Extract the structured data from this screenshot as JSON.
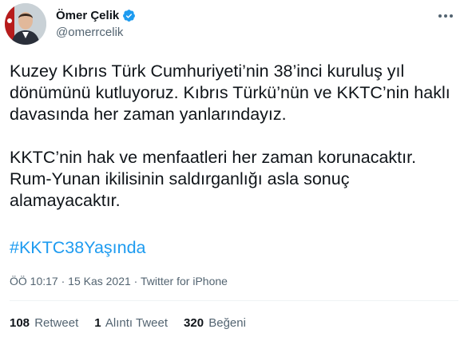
{
  "user": {
    "display_name": "Ömer Çelik",
    "handle": "@omerrcelik",
    "verified": true,
    "avatar_icon": "person-portrait"
  },
  "tweet": {
    "paragraph1": "Kuzey Kıbrıs Türk Cumhuriyeti’nin 38’inci kuruluş yıl dönümünü kutluyoruz. Kıbrıs Türkü’nün ve KKTC’nin haklı davasında her zaman yanlarındayız.",
    "paragraph2": "KKTC’nin hak ve menfaatleri her zaman korunacaktır. Rum-Yunan ikilisinin saldırganlığı asla sonuç alamayacaktır.",
    "hashtag": "#KKTC38Yaşında"
  },
  "meta": {
    "time": "ÖÖ 10:17",
    "separator": " · ",
    "date": "15 Kas 2021",
    "app": "Twitter for iPhone"
  },
  "stats": {
    "retweets_count": "108",
    "retweets_label": "Retweet",
    "quotes_count": "1",
    "quotes_label": "Alıntı Tweet",
    "likes_count": "320",
    "likes_label": "Beğeni"
  },
  "colors": {
    "link": "#1d9bf0",
    "secondary_text": "#536471",
    "verified_badge": "#1d9bf0"
  }
}
